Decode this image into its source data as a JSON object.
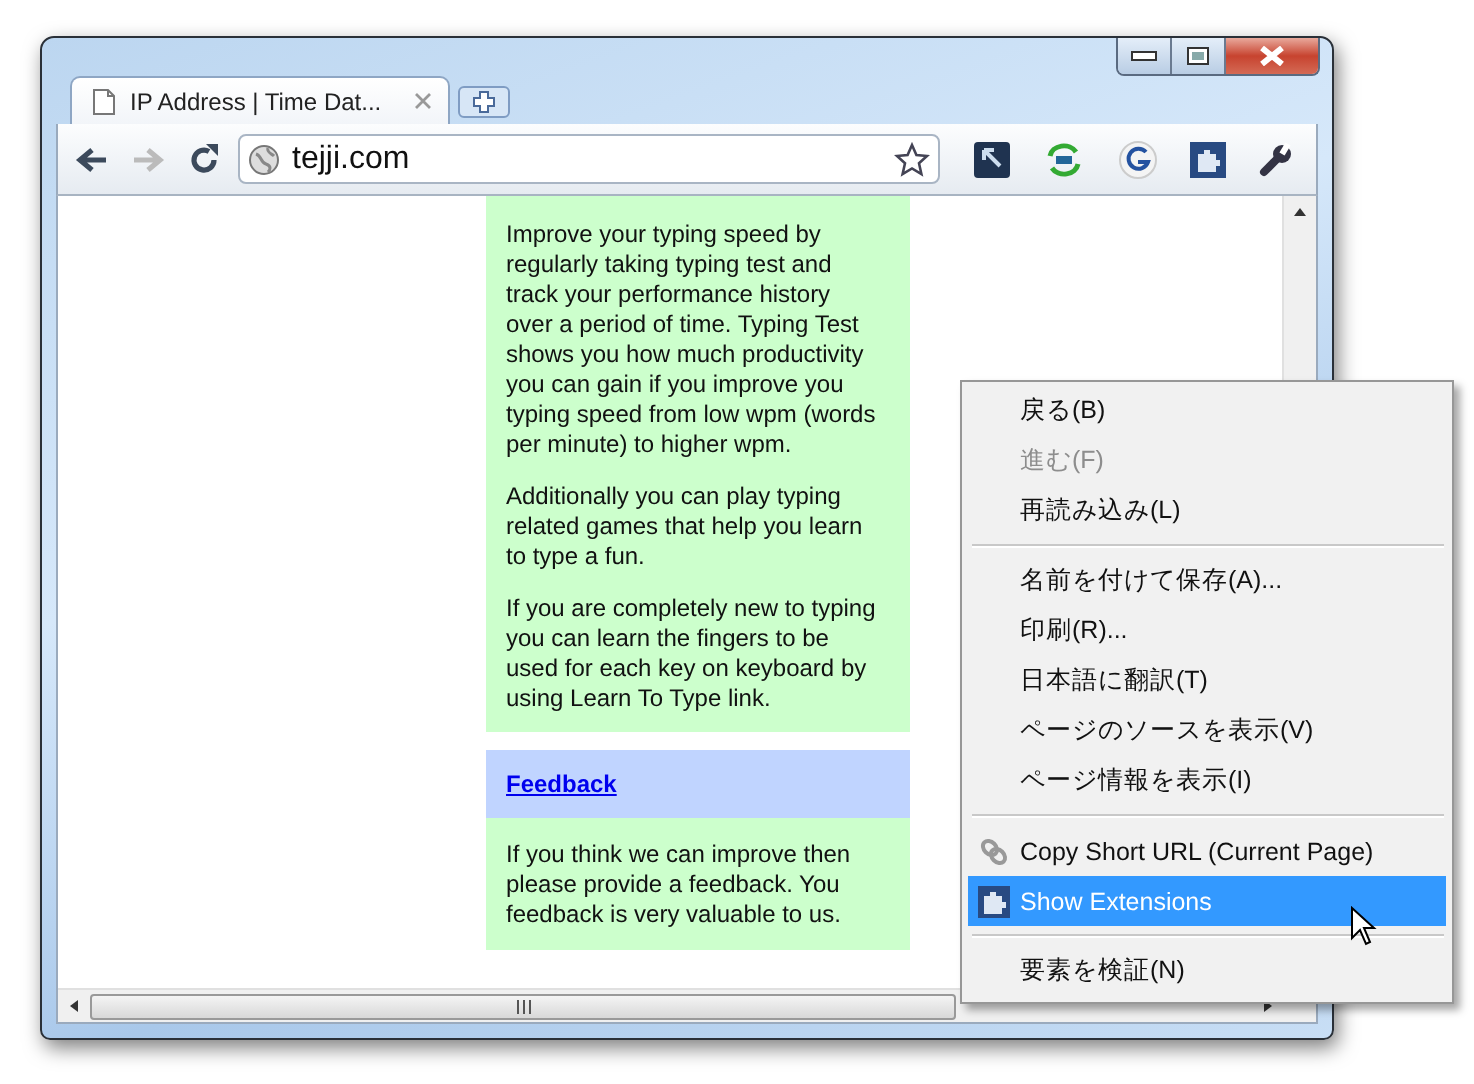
{
  "tabs": [
    {
      "title": "IP Address | Time Dat...",
      "selected": true
    }
  ],
  "toolbar": {
    "address": "tejji.com",
    "back_disabled": false,
    "forward_disabled": true
  },
  "page": {
    "paragraphs": [
      "Improve your typing speed by regularly taking typing test and track your performance history over a period of time. Typing Test shows you how much productivity you can gain if you improve you typing speed from low wpm (words per minute) to higher wpm.",
      "Additionally you can play typing related games that help you learn to type a fun.",
      "If you are completely new to typing you can learn the fingers to be used for each key on keyboard by using Learn To Type link."
    ],
    "feedback_link": "Feedback",
    "feedback_text": "If you think we can improve then please provide a feedback. You feedback is very valuable to us."
  },
  "context_menu": {
    "groups": [
      [
        {
          "label": "戻る(B)",
          "disabled": false,
          "selected": false
        },
        {
          "label": "進む(F)",
          "disabled": true,
          "selected": false
        },
        {
          "label": "再読み込み(L)",
          "disabled": false,
          "selected": false
        }
      ],
      [
        {
          "label": "名前を付けて保存(A)...",
          "disabled": false,
          "selected": false
        },
        {
          "label": "印刷(R)...",
          "disabled": false,
          "selected": false
        },
        {
          "label": "日本語に翻訳(T)",
          "disabled": false,
          "selected": false
        },
        {
          "label": "ページのソースを表示(V)",
          "disabled": false,
          "selected": false
        },
        {
          "label": "ページ情報を表示(I)",
          "disabled": false,
          "selected": false
        }
      ],
      [
        {
          "label": "Copy Short URL (Current Page)",
          "disabled": false,
          "selected": false
        },
        {
          "label": "Show Extensions",
          "disabled": false,
          "selected": true
        }
      ],
      [
        {
          "label": "要素を検証(N)",
          "disabled": false,
          "selected": false
        }
      ]
    ]
  }
}
